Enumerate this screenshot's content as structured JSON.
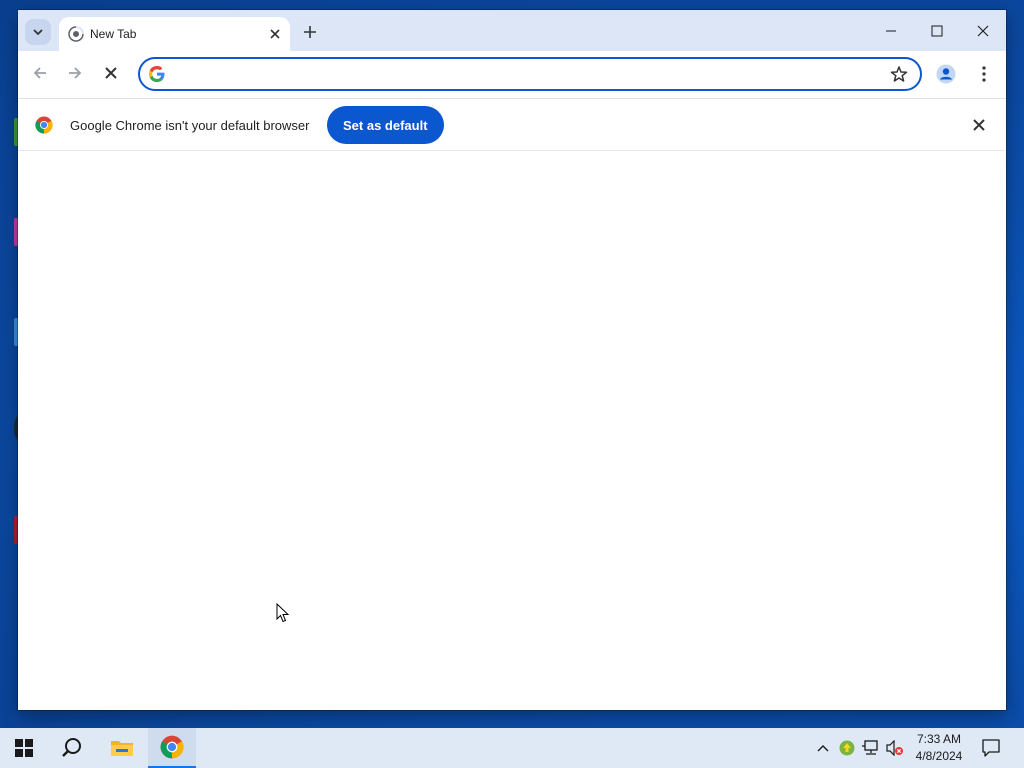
{
  "browser": {
    "tab": {
      "title": "New Tab"
    },
    "omnibox": {
      "value": "",
      "placeholder": ""
    },
    "infobar": {
      "message": "Google Chrome isn't your default browser",
      "button_label": "Set as default"
    }
  },
  "taskbar": {
    "clock": {
      "time": "7:33 AM",
      "date": "4/8/2024"
    }
  },
  "colors": {
    "accent": "#0b57d0",
    "titlebar": "#dce6f6",
    "taskbar": "#dfe9f5"
  },
  "icons": {
    "tab_strip": [
      "tab-search-icon",
      "chrome-favicon-icon",
      "close-icon",
      "plus-icon"
    ],
    "window": [
      "minimize-icon",
      "maximize-icon",
      "close-icon"
    ],
    "toolbar": [
      "back-arrow-icon",
      "forward-arrow-icon",
      "stop-icon",
      "google-g-icon",
      "star-icon",
      "profile-icon",
      "more-vert-icon"
    ],
    "taskbar": [
      "windows-start-icon",
      "search-icon",
      "file-explorer-icon",
      "chrome-icon"
    ],
    "tray": [
      "chevron-up-icon",
      "update-shield-icon",
      "network-icon",
      "volume-muted-icon",
      "notification-icon"
    ]
  }
}
